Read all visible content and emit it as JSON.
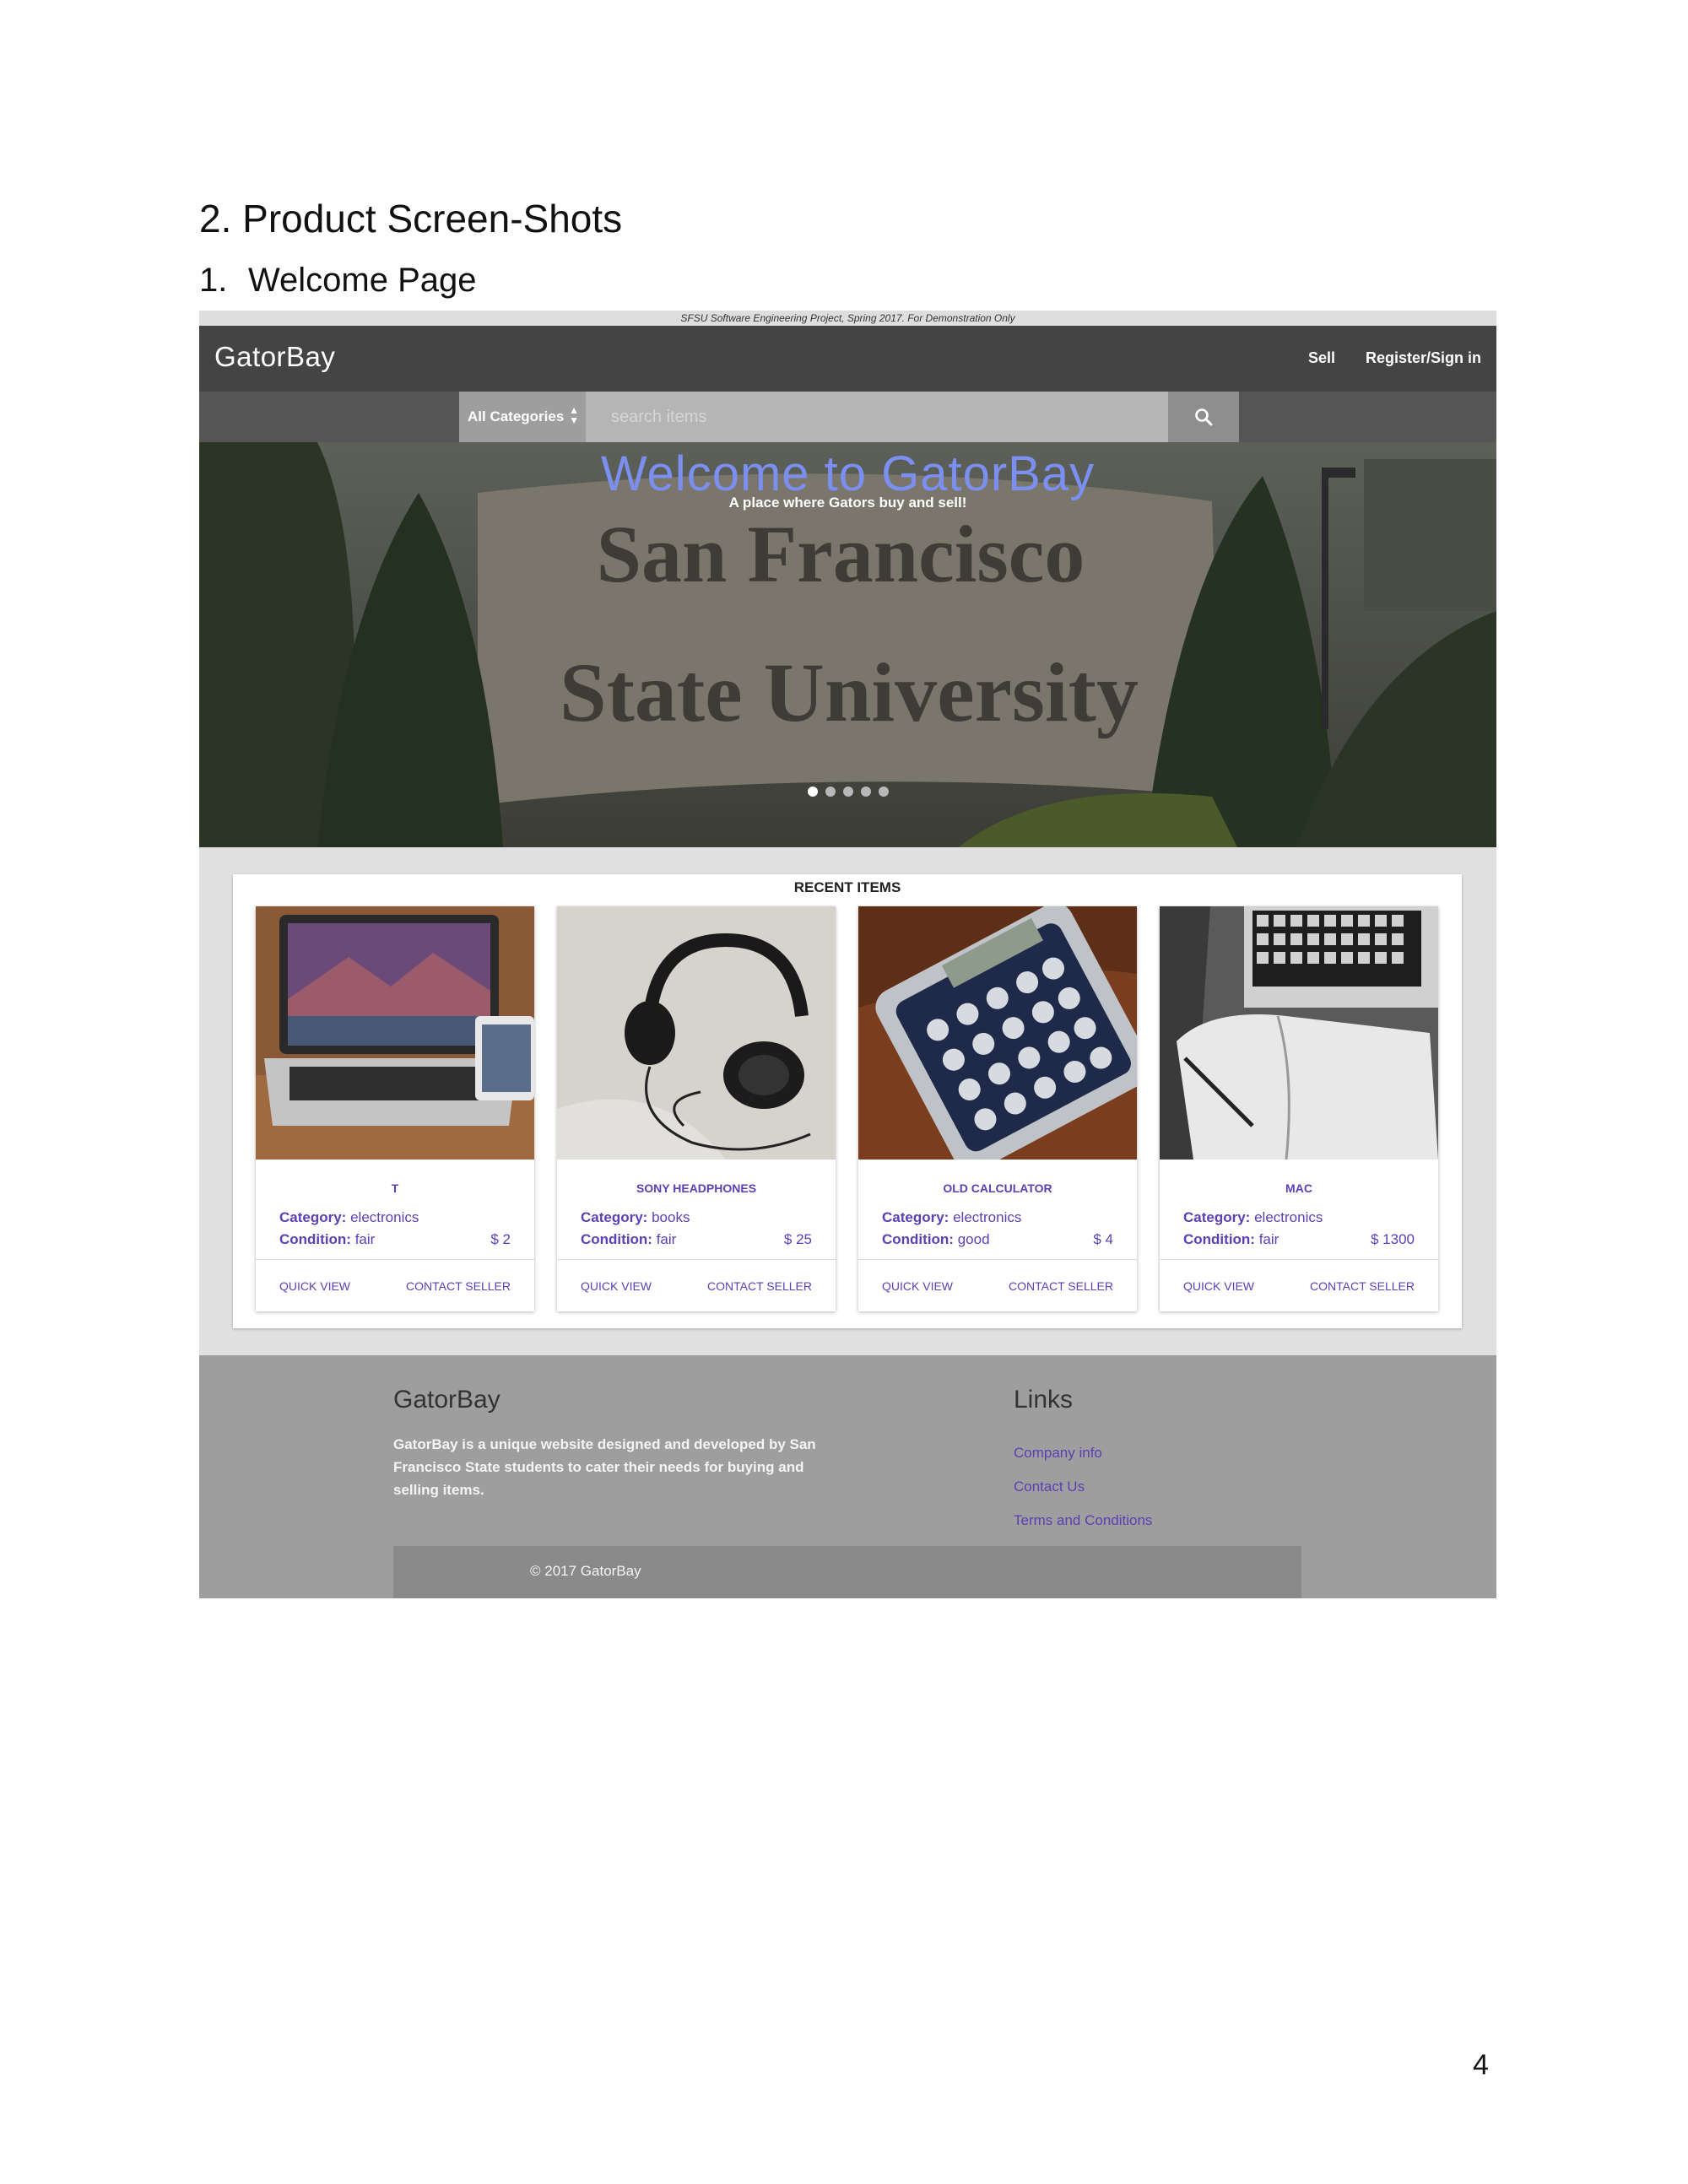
{
  "document": {
    "heading": "2. Product Screen-Shots",
    "subheading_num": "1.",
    "subheading_text": "Welcome Page",
    "page_number": "4"
  },
  "app": {
    "disclaimer": "SFSU Software Engineering Project, Spring 2017. For Demonstration Only",
    "brand": "GatorBay",
    "nav": {
      "sell": "Sell",
      "register": "Register/Sign in"
    },
    "search": {
      "category": "All Categories",
      "placeholder": "search items",
      "icon": "search-icon"
    },
    "hero": {
      "title": "Welcome to GatorBay",
      "subtitle": "A place where Gators buy and sell!",
      "sign_line1": "San Francisco",
      "sign_line2": "State University",
      "slides_total": 5,
      "active_slide": 1
    },
    "recent": {
      "title": "RECENT ITEMS",
      "category_label": "Category:",
      "condition_label": "Condition:",
      "quick_view": "QUICK VIEW",
      "contact_seller": "CONTACT SELLER",
      "items": [
        {
          "name": "T",
          "category": "electronics",
          "condition": "fair",
          "price": "$ 2",
          "image": "laptop-image"
        },
        {
          "name": "SONY HEADPHONES",
          "category": "books",
          "condition": "fair",
          "price": "$ 25",
          "image": "headphones-image"
        },
        {
          "name": "OLD CALCULATOR",
          "category": "electronics",
          "condition": "good",
          "price": "$ 4",
          "image": "calculator-image"
        },
        {
          "name": "MAC",
          "category": "electronics",
          "condition": "fair",
          "price": "$ 1300",
          "image": "mac-notebook-image"
        }
      ]
    },
    "footer": {
      "brand": "GatorBay",
      "description": "GatorBay is a unique website designed and developed by San Francisco State students to cater their needs for buying and selling items.",
      "links_title": "Links",
      "links": [
        "Company info",
        "Contact Us",
        "Terms and Conditions"
      ],
      "copyright": "© 2017 GatorBay"
    },
    "colors": {
      "nav": "#444444",
      "accent": "#5b3fb3",
      "hero_title": "#7b8ff0",
      "footer": "#9e9e9e"
    }
  }
}
